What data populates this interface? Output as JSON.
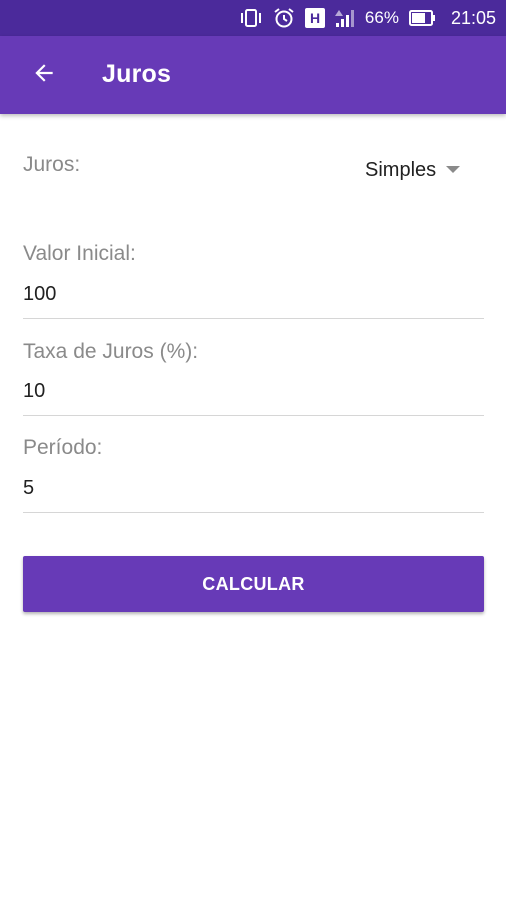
{
  "status_bar": {
    "battery_percent": "66%",
    "time": "21:05",
    "icons": [
      "vibrate-icon",
      "alarm-icon",
      "h-network-icon",
      "signal-icon",
      "battery-icon"
    ]
  },
  "app_bar": {
    "title": "Juros",
    "back_icon": "arrow-back-icon",
    "color": "#673ab7"
  },
  "form": {
    "juros_label": "Juros:",
    "juros_selected": "Simples",
    "valor_inicial_label": "Valor Inicial:",
    "valor_inicial_value": "100",
    "taxa_label": "Taxa de Juros (%):",
    "taxa_value": "10",
    "periodo_label": "Período:",
    "periodo_value": "5"
  },
  "actions": {
    "calcular_label": "CALCULAR",
    "button_color": "#673ab7"
  }
}
